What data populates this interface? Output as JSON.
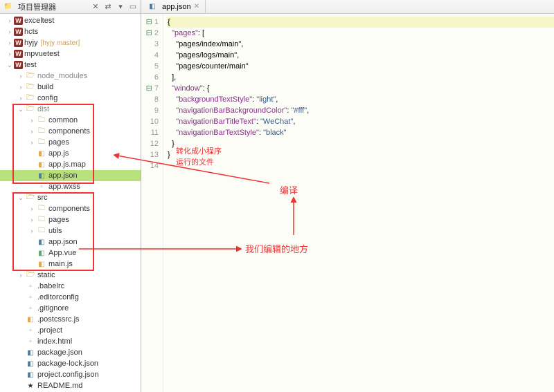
{
  "panel": {
    "title": "项目管理器"
  },
  "tree": {
    "items": [
      {
        "d": 0,
        "exp": ">",
        "ico": "w",
        "label": "exceltest"
      },
      {
        "d": 0,
        "exp": ">",
        "ico": "w",
        "label": "hcts"
      },
      {
        "d": 0,
        "exp": ">",
        "ico": "w",
        "label": "hyjy",
        "branch": "[hyjy master]"
      },
      {
        "d": 0,
        "exp": ">",
        "ico": "w",
        "label": "mpvuetest"
      },
      {
        "d": 0,
        "exp": "v",
        "ico": "w",
        "label": "test"
      },
      {
        "d": 1,
        "exp": ">",
        "ico": "fold",
        "label": "node_modules",
        "gray": true
      },
      {
        "d": 1,
        "exp": ">",
        "ico": "fold",
        "label": "build"
      },
      {
        "d": 1,
        "exp": ">",
        "ico": "fold",
        "label": "config"
      },
      {
        "d": 1,
        "exp": "v",
        "ico": "fold",
        "label": "dist",
        "gray": true
      },
      {
        "d": 2,
        "exp": ">",
        "ico": "foldc",
        "label": "common"
      },
      {
        "d": 2,
        "exp": ">",
        "ico": "foldc",
        "label": "components"
      },
      {
        "d": 2,
        "exp": ">",
        "ico": "foldc",
        "label": "pages"
      },
      {
        "d": 2,
        "exp": "",
        "ico": "js",
        "label": "app.js"
      },
      {
        "d": 2,
        "exp": "",
        "ico": "js",
        "label": "app.js.map"
      },
      {
        "d": 2,
        "exp": "",
        "ico": "json",
        "label": "app.json",
        "sel": true
      },
      {
        "d": 2,
        "exp": "",
        "ico": "file",
        "label": "app.wxss"
      },
      {
        "d": 1,
        "exp": "v",
        "ico": "fold",
        "label": "src"
      },
      {
        "d": 2,
        "exp": ">",
        "ico": "foldc",
        "label": "components"
      },
      {
        "d": 2,
        "exp": ">",
        "ico": "foldc",
        "label": "pages"
      },
      {
        "d": 2,
        "exp": ">",
        "ico": "foldc",
        "label": "utils"
      },
      {
        "d": 2,
        "exp": "",
        "ico": "json",
        "label": "app.json"
      },
      {
        "d": 2,
        "exp": "",
        "ico": "vue",
        "label": "App.vue"
      },
      {
        "d": 2,
        "exp": "",
        "ico": "js",
        "label": "main.js"
      },
      {
        "d": 1,
        "exp": ">",
        "ico": "fold",
        "label": "static"
      },
      {
        "d": 1,
        "exp": "",
        "ico": "file",
        "label": ".babelrc"
      },
      {
        "d": 1,
        "exp": "",
        "ico": "file",
        "label": ".editorconfig"
      },
      {
        "d": 1,
        "exp": "",
        "ico": "file",
        "label": ".gitignore"
      },
      {
        "d": 1,
        "exp": "",
        "ico": "js",
        "label": ".postcssrc.js"
      },
      {
        "d": 1,
        "exp": "",
        "ico": "file",
        "label": ".project"
      },
      {
        "d": 1,
        "exp": "",
        "ico": "file",
        "label": "index.html"
      },
      {
        "d": 1,
        "exp": "",
        "ico": "json",
        "label": "package.json"
      },
      {
        "d": 1,
        "exp": "",
        "ico": "json",
        "label": "package-lock.json"
      },
      {
        "d": 1,
        "exp": "",
        "ico": "json",
        "label": "project.config.json"
      },
      {
        "d": 1,
        "exp": "",
        "ico": "star",
        "label": "README.md"
      }
    ]
  },
  "editor": {
    "tab": "app.json",
    "lines": [
      "{",
      "  \"pages\": [",
      "    \"pages/index/main\",",
      "    \"pages/logs/main\",",
      "    \"pages/counter/main\"",
      "  ],",
      "  \"window\": {",
      "    \"backgroundTextStyle\": \"light\",",
      "    \"navigationBarBackgroundColor\": \"#fff\",",
      "    \"navigationBarTitleText\": \"WeChat\",",
      "    \"navigationBarTextStyle\": \"black\"",
      "  }",
      "}"
    ]
  },
  "annotations": {
    "a1l1": "转化成小程序",
    "a1l2": "运行的文件",
    "a2": "编译",
    "a3": "我们编辑的地方"
  }
}
